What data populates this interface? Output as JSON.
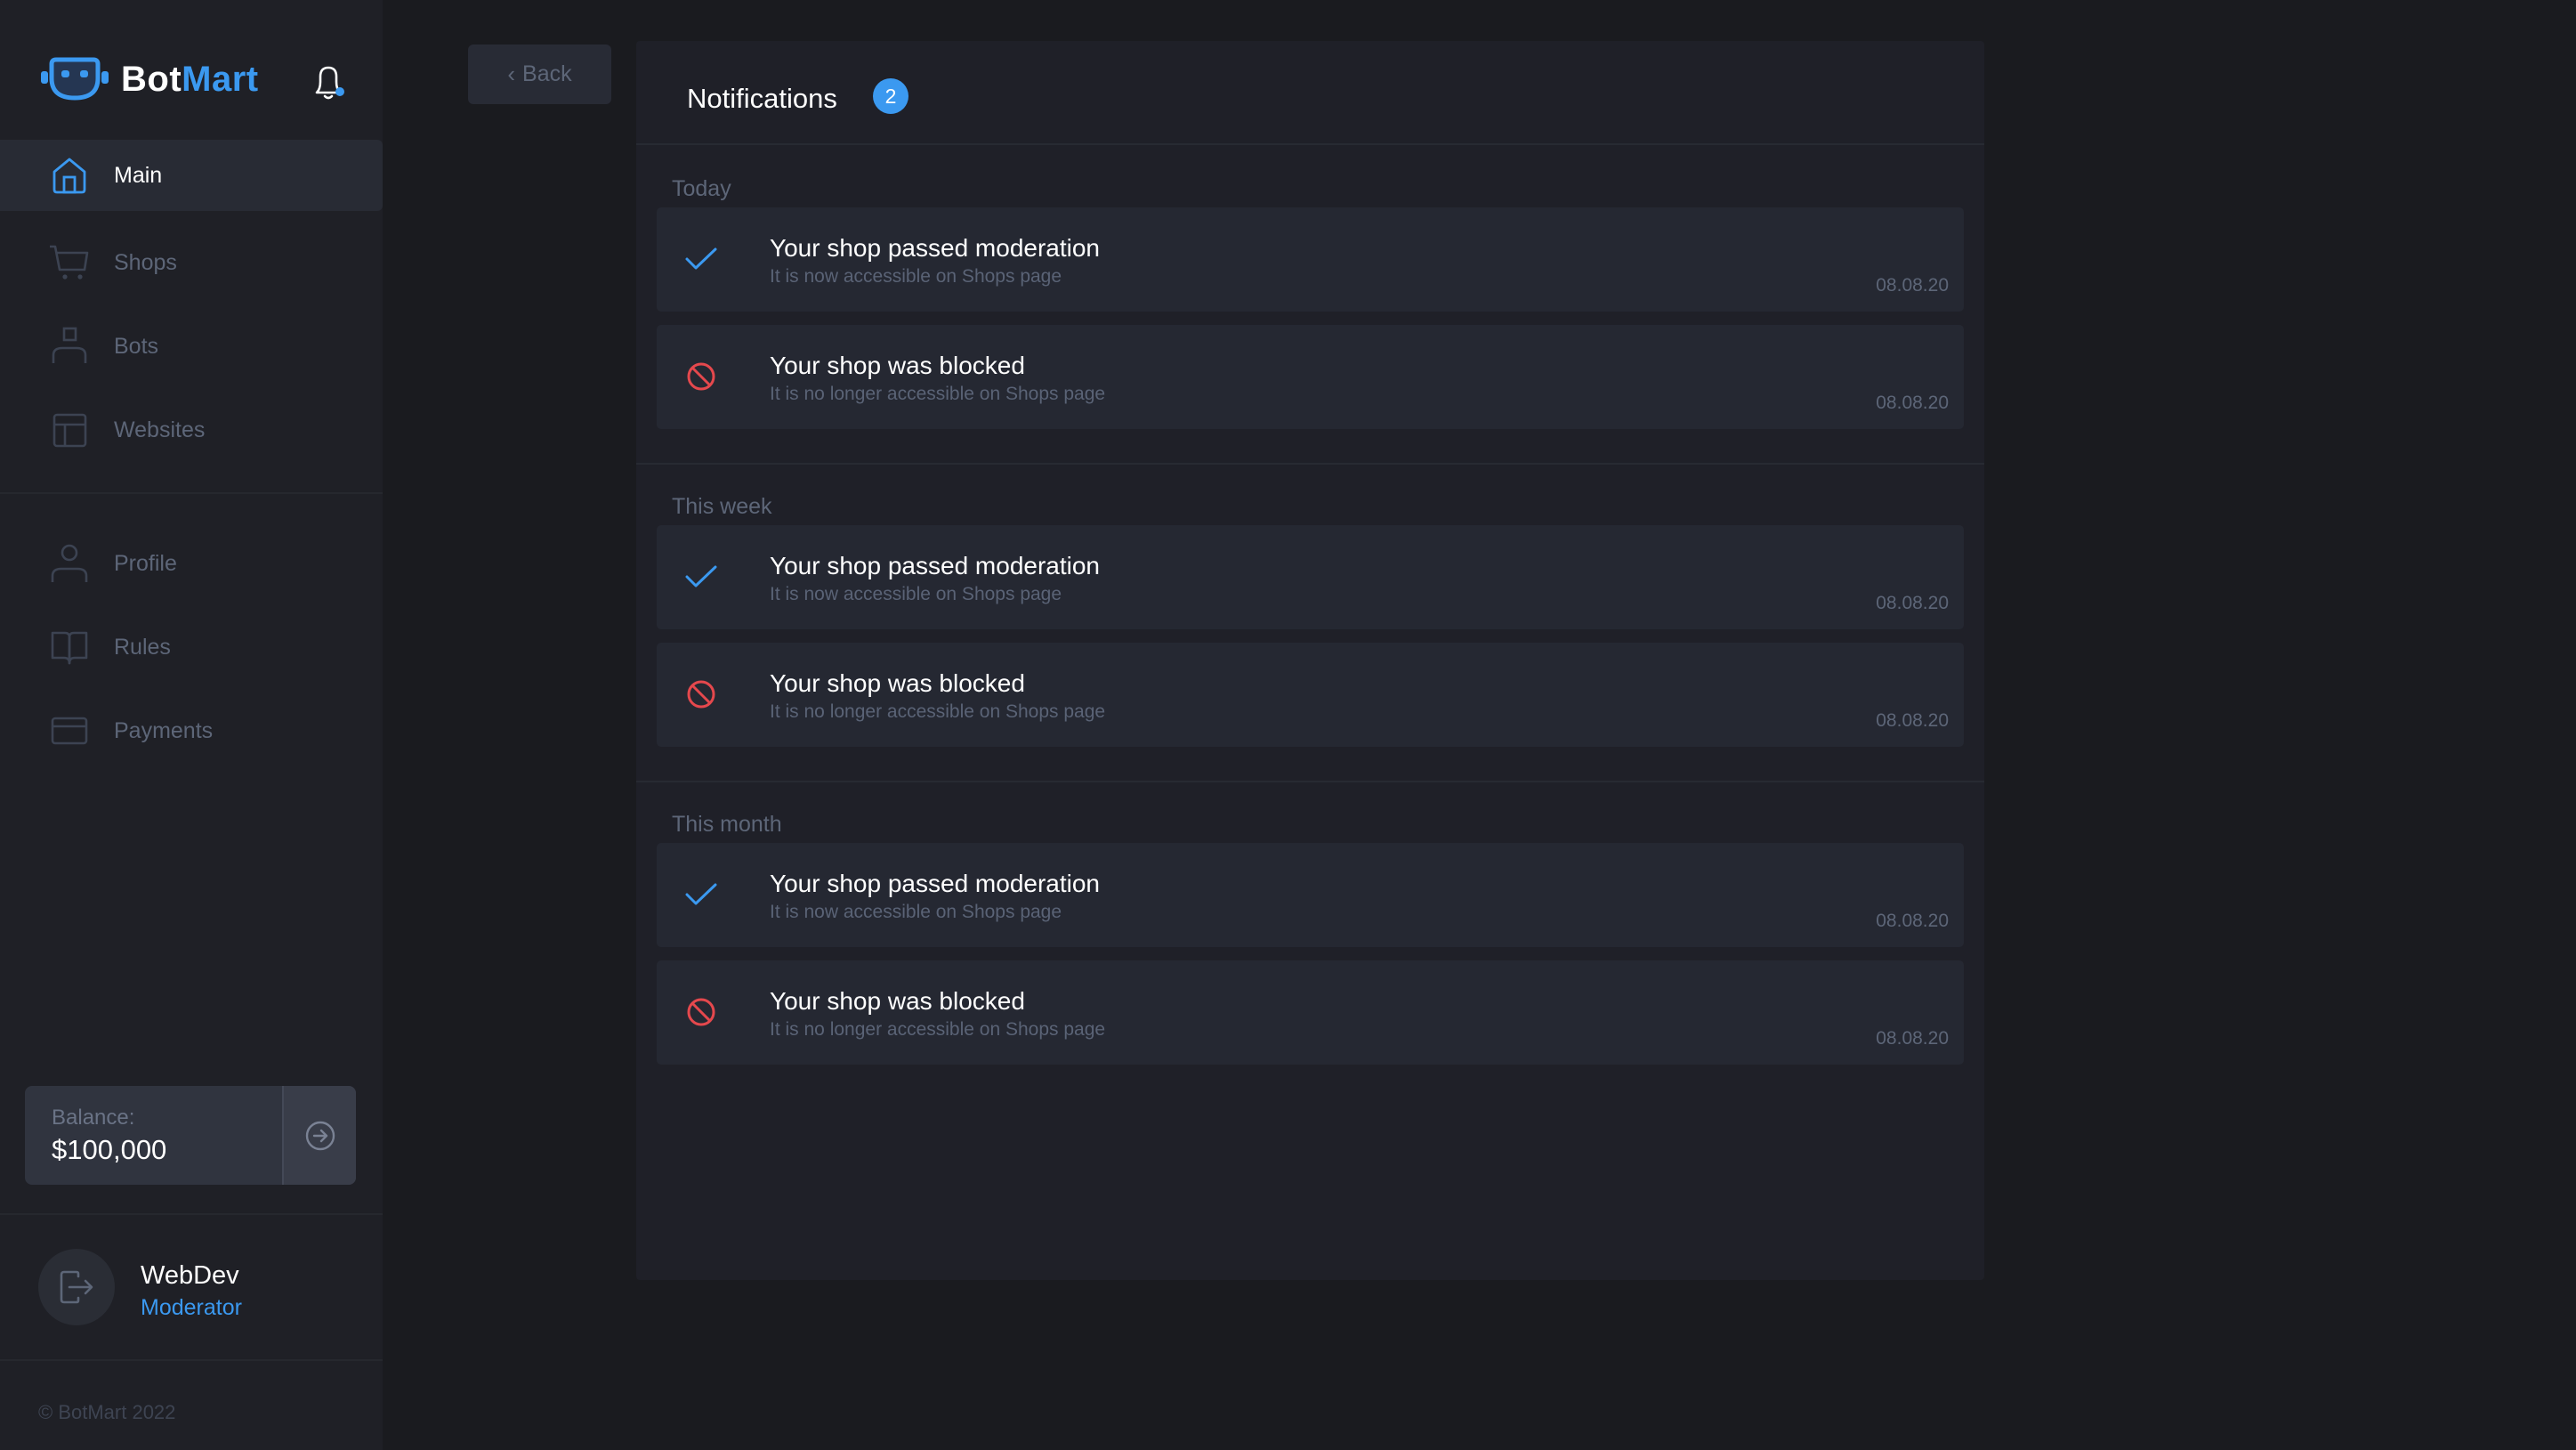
{
  "brand": {
    "name_part1": "Bot",
    "name_part2": "Mart",
    "accent_color": "#3b99f0"
  },
  "header": {
    "bell_icon": "bell-icon",
    "bell_has_dot": true
  },
  "sidebar": {
    "primary_items": [
      {
        "label": "Main",
        "icon": "home-icon",
        "active": true
      },
      {
        "label": "Shops",
        "icon": "cart-icon",
        "active": false
      },
      {
        "label": "Bots",
        "icon": "bot-user-icon",
        "active": false
      },
      {
        "label": "Websites",
        "icon": "layout-icon",
        "active": false
      }
    ],
    "secondary_items": [
      {
        "label": "Profile",
        "icon": "user-icon",
        "active": false
      },
      {
        "label": "Rules",
        "icon": "book-icon",
        "active": false
      },
      {
        "label": "Payments",
        "icon": "card-icon",
        "active": false
      }
    ],
    "balance": {
      "label": "Balance:",
      "value": "$100,000",
      "action_icon": "arrow-right-circle-icon"
    },
    "user": {
      "name": "WebDev",
      "role": "Moderator",
      "avatar_icon": "logout-icon"
    },
    "copyright": "© BotMart 2022"
  },
  "back_button": {
    "label": "Back"
  },
  "notifications": {
    "title": "Notifications",
    "unread_count": "2",
    "sections": [
      {
        "label": "Today",
        "items": [
          {
            "type": "success",
            "icon": "check-icon",
            "title": "Your shop passed moderation",
            "subtitle": "It is now accessible on Shops page",
            "date": "08.08.20"
          },
          {
            "type": "blocked",
            "icon": "blocked-icon",
            "title": "Your shop was blocked",
            "subtitle": "It is no longer accessible on Shops page",
            "date": "08.08.20"
          }
        ]
      },
      {
        "label": "This week",
        "items": [
          {
            "type": "success",
            "icon": "check-icon",
            "title": "Your shop passed moderation",
            "subtitle": "It is now accessible on Shops page",
            "date": "08.08.20"
          },
          {
            "type": "blocked",
            "icon": "blocked-icon",
            "title": "Your shop was blocked",
            "subtitle": "It is no longer accessible on Shops page",
            "date": "08.08.20"
          }
        ]
      },
      {
        "label": "This month",
        "items": [
          {
            "type": "success",
            "icon": "check-icon",
            "title": "Your shop passed moderation",
            "subtitle": "It is now accessible on Shops page",
            "date": "08.08.20"
          },
          {
            "type": "blocked",
            "icon": "blocked-icon",
            "title": "Your shop was blocked",
            "subtitle": "It is no longer accessible on Shops page",
            "date": "08.08.20"
          }
        ]
      }
    ]
  },
  "colors": {
    "success": "#3b99f0",
    "blocked": "#e5484d",
    "muted_text": "#5d6678"
  }
}
